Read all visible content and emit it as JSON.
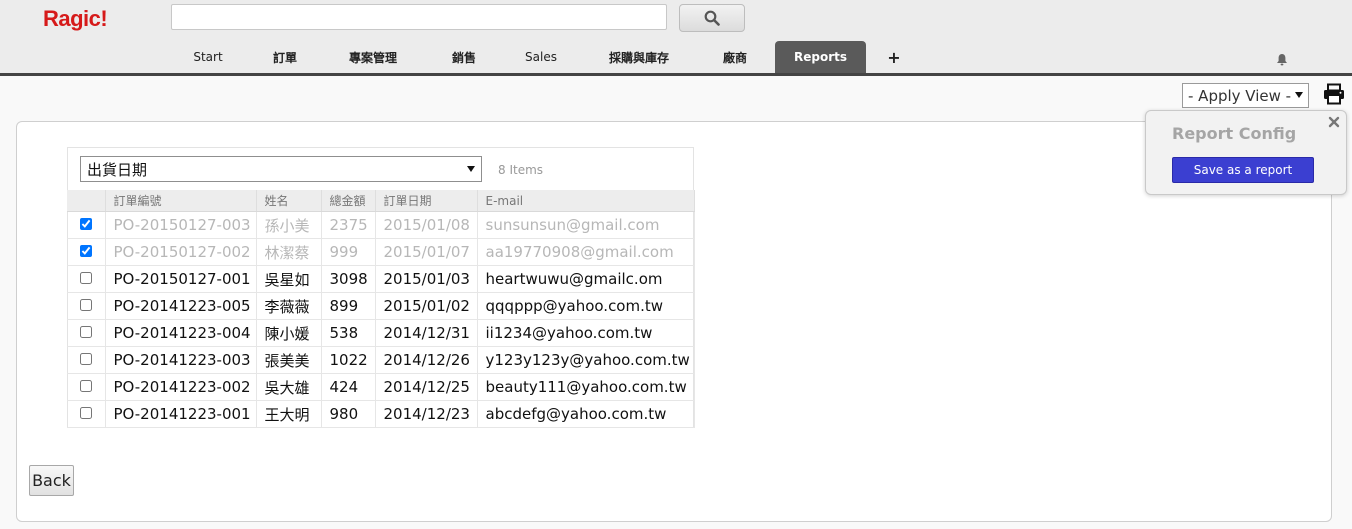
{
  "app": {
    "logo_text": "Ragic!"
  },
  "search": {
    "placeholder": "",
    "value": "",
    "icon": "search-icon"
  },
  "nav": {
    "tabs": [
      {
        "label": "Start",
        "active": false
      },
      {
        "label": "訂單",
        "active": false
      },
      {
        "label": "專案管理",
        "active": false
      },
      {
        "label": "銷售",
        "active": false
      },
      {
        "label": "Sales",
        "active": false
      },
      {
        "label": "採購與庫存",
        "active": false
      },
      {
        "label": "廠商",
        "active": false
      },
      {
        "label": "Reports",
        "active": true
      }
    ],
    "add_tab_label": "+",
    "notification_icon": "bell-icon"
  },
  "toolbar": {
    "apply_view_label": "- Apply View -",
    "print_icon": "printer-icon"
  },
  "report_panel": {
    "group_by_selected": "出貨日期",
    "item_count": "8 Items",
    "columns": [
      "",
      "訂單編號",
      "姓名",
      "總金額",
      "訂單日期",
      "E-mail"
    ],
    "rows": [
      {
        "checked": true,
        "order_no": "PO-20150127-003",
        "name": "孫小美",
        "amount": "2375",
        "date": "2015/01/08",
        "email": "sunsunsun@gmail.com"
      },
      {
        "checked": true,
        "order_no": "PO-20150127-002",
        "name": "林潔蔡",
        "amount": "999",
        "date": "2015/01/07",
        "email": "aa19770908@gmail.com"
      },
      {
        "checked": false,
        "order_no": "PO-20150127-001",
        "name": "吳星如",
        "amount": "3098",
        "date": "2015/01/03",
        "email": "heartwuwu@gmailc.om"
      },
      {
        "checked": false,
        "order_no": "PO-20141223-005",
        "name": "李薇薇",
        "amount": "899",
        "date": "2015/01/02",
        "email": "qqqppp@yahoo.com.tw"
      },
      {
        "checked": false,
        "order_no": "PO-20141223-004",
        "name": "陳小媛",
        "amount": "538",
        "date": "2014/12/31",
        "email": "ii1234@yahoo.com.tw"
      },
      {
        "checked": false,
        "order_no": "PO-20141223-003",
        "name": "張美美",
        "amount": "1022",
        "date": "2014/12/26",
        "email": "y123y123y@yahoo.com.tw"
      },
      {
        "checked": false,
        "order_no": "PO-20141223-002",
        "name": "吳大雄",
        "amount": "424",
        "date": "2014/12/25",
        "email": "beauty111@yahoo.com.tw"
      },
      {
        "checked": false,
        "order_no": "PO-20141223-001",
        "name": "王大明",
        "amount": "980",
        "date": "2014/12/23",
        "email": "abcdefg@yahoo.com.tw"
      }
    ],
    "back_label": "Back"
  },
  "report_config": {
    "title": "Report Config",
    "save_label": "Save as a report",
    "close_icon": "close-icon"
  },
  "colors": {
    "logo": "#d61a1a",
    "active_tab": "#5a5a5a",
    "primary_button": "#3b3fd1",
    "muted_text": "#b7b7b7"
  }
}
